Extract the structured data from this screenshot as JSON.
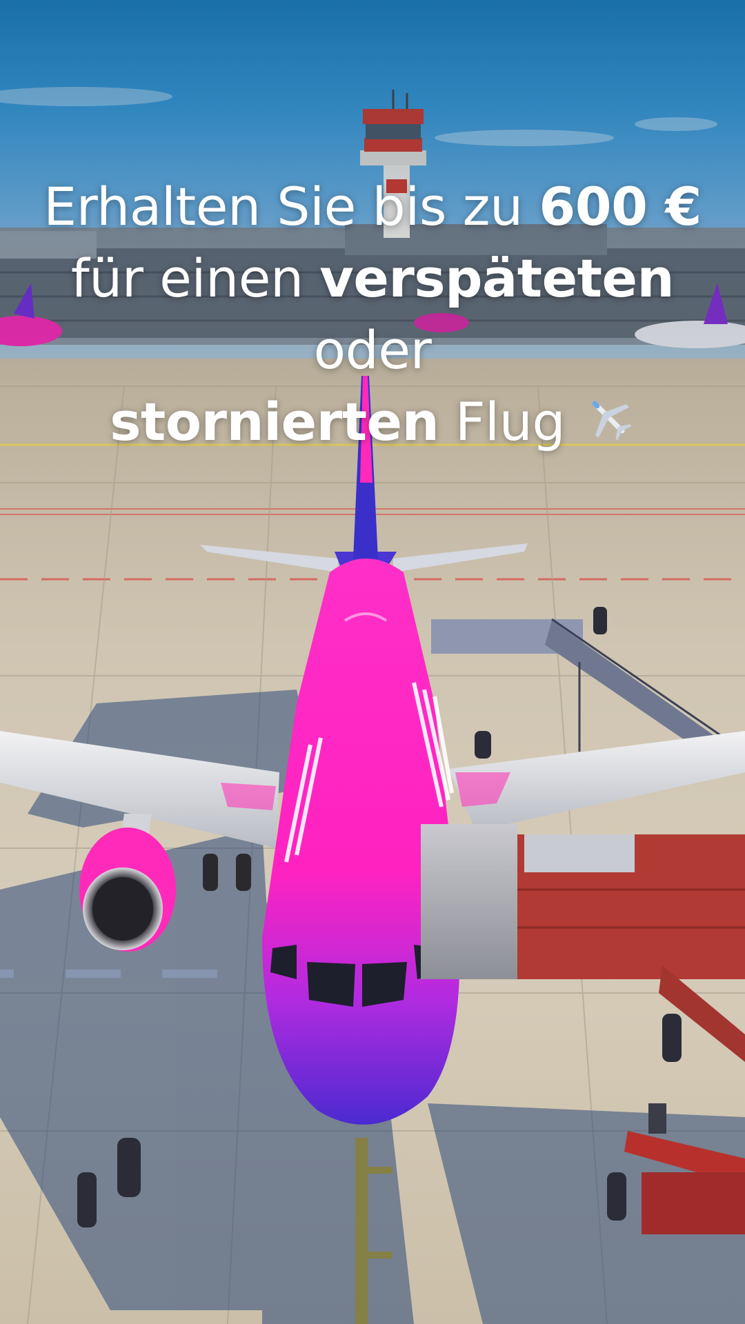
{
  "headline": {
    "line1_prefix": "Erhalten Sie bis zu ",
    "line1_bold": "600 €",
    "line2_prefix": "für einen ",
    "line2_bold": "verspäteten",
    "line2_suffix": " oder",
    "line3_bold": "stornierten",
    "line3_suffix": " Flug ",
    "emoji_icon": "airplane-icon"
  },
  "colors": {
    "aircraft_pink": "#ff1fbf",
    "aircraft_purple": "#5b2bd6",
    "sky_blue": "#1f86c9",
    "tarmac": "#cfc5b2",
    "text": "#ffffff"
  }
}
